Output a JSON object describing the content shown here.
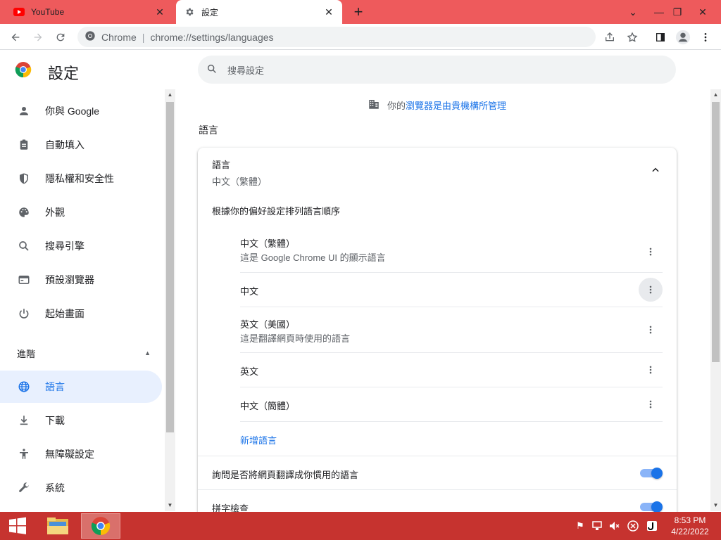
{
  "browser": {
    "tabs": [
      {
        "label": "YouTube",
        "icon": "youtube-icon"
      },
      {
        "label": "設定",
        "icon": "gear-icon"
      }
    ],
    "address_site": "Chrome",
    "address_url": "chrome://settings/languages"
  },
  "settings": {
    "title": "設定",
    "search_placeholder": "搜尋設定"
  },
  "sidebar": {
    "items": [
      {
        "label": "你與 Google",
        "icon": "person-icon"
      },
      {
        "label": "自動填入",
        "icon": "clipboard-icon"
      },
      {
        "label": "隱私權和安全性",
        "icon": "shield-icon"
      },
      {
        "label": "外觀",
        "icon": "palette-icon"
      },
      {
        "label": "搜尋引擎",
        "icon": "search-icon"
      },
      {
        "label": "預設瀏覽器",
        "icon": "browser-icon"
      },
      {
        "label": "起始畫面",
        "icon": "power-icon"
      }
    ],
    "advanced_label": "進階",
    "advanced_items": [
      {
        "label": "語言",
        "icon": "globe-icon",
        "selected": true
      },
      {
        "label": "下載",
        "icon": "download-icon"
      },
      {
        "label": "無障礙設定",
        "icon": "accessibility-icon"
      },
      {
        "label": "系統",
        "icon": "wrench-icon"
      }
    ]
  },
  "main": {
    "managed_prefix": "你的",
    "managed_link": "瀏覽器是由貴機構所管理",
    "section_title": "語言",
    "card": {
      "heading": "語言",
      "current": "中文（繁體）",
      "order_label": "根據你的偏好設定排列語言順序",
      "languages": [
        {
          "name": "中文（繁體）",
          "desc": "這是 Google Chrome UI 的顯示語言"
        },
        {
          "name": "中文",
          "desc": ""
        },
        {
          "name": "英文（美國）",
          "desc": "這是翻譯網頁時使用的語言"
        },
        {
          "name": "英文",
          "desc": ""
        },
        {
          "name": "中文（簡體）",
          "desc": ""
        }
      ],
      "add_language": "新增語言",
      "offer_translate": "詢問是否將網頁翻譯成你慣用的語言",
      "spell_check": "拼字檢查"
    }
  },
  "toggles": {
    "offer_translate": true,
    "spell_check": true
  },
  "taskbar": {
    "time": "8:53 PM",
    "date": "4/22/2022"
  },
  "colors": {
    "tabstrip": "#ee5a5c",
    "accent": "#1a73e8",
    "taskbar": "#c6332f",
    "selected_nav": "#e8f0fe"
  }
}
